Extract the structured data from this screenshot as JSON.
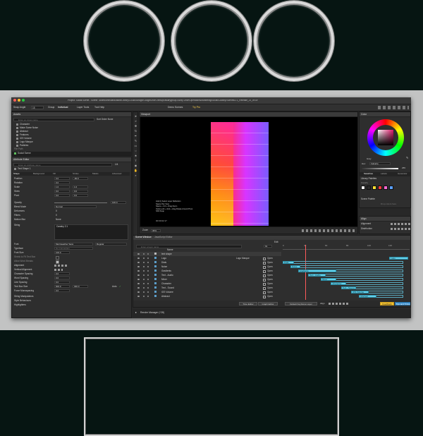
{
  "window": {
    "title": "Project: Social Scene - Scene: /Users/chrishardcastle/Library/CloudStorage/GoogleDrive-chris@cavalrygroup.co/My Drive/Operations/Marketing/Social/Cavalry/Scenes/2.1_Release_21_ch.cv"
  },
  "toolbar": {
    "snap_angle_label": "Snap Angle",
    "snap_angle_value": "15",
    "group_label": "Group",
    "individual_label": "Individual",
    "layer_tools_label": "Layer Tools",
    "tool_help_label": "Tool Help",
    "demo_scenes_label": "Demo Scenes",
    "try_pro_label": "Try Pro"
  },
  "assets": {
    "header": "Assets",
    "search_placeholder": "Enter an Asset name",
    "sort_label": "Sort Order",
    "sort_value": "None",
    "items": [
      "Character",
      "Make Some Noise",
      "Abstract",
      "Features",
      "iOS Volume",
      "Logo Marque",
      "Particles"
    ],
    "file_path_label": "File Path",
    "scene_name": "Social Scene",
    "size_label": "Size"
  },
  "attribute_editor": {
    "header": "Attribute Editor",
    "search_placeholder": "Enter an Attribute name",
    "page": "1/4",
    "layer_name": "Text Shape 1",
    "tabs": [
      "Shape",
      "Background",
      "Fill",
      "Stroke",
      "Masks",
      "Advanced"
    ],
    "rows": [
      {
        "label": "Position",
        "a": "0.0",
        "b": "-80.0"
      },
      {
        "label": "Rotation",
        "a": "0.0",
        "b": ""
      },
      {
        "label": "Scale",
        "a": "1.0",
        "b": "1.0"
      },
      {
        "label": "Skew",
        "a": "0.0",
        "b": "0.0"
      },
      {
        "label": "Pivot",
        "a": "0.0",
        "b": "0.0"
      }
    ],
    "opacity_label": "Opacity",
    "opacity_value": "100.0",
    "blend_mode_label": "Blend Mode",
    "blend_mode_value": "Normal",
    "deformers_label": "Deformers",
    "deformers_value": "0",
    "filters_label": "Filters",
    "filters_value": "0",
    "motion_blur_label": "Motion Blur",
    "motion_blur_value": "None",
    "string_label": "String",
    "string_value": "Cavalry 2.1",
    "font_label": "Font",
    "font_value": "Merriweather Sans",
    "font_style": "Regular",
    "typeface_label": "Typeface",
    "typeface_value": "No Connection",
    "font_size_label": "Font Size",
    "font_size_value": "100.0",
    "shrink_label": "Shrink to Fit Text Box",
    "allow_breaks_label": "Allow Word Breaks",
    "alignment_label": "Alignment",
    "vertical_alignment_label": "Vertical Alignment",
    "character_spacing_label": "Character Spacing",
    "character_spacing_value": "0.0",
    "word_spacing_label": "Word Spacing",
    "word_spacing_value": "0.0",
    "line_spacing_label": "Line Spacing",
    "line_spacing_value": "0.0",
    "text_box_size_label": "Text Box Size",
    "text_box_w": "600.0",
    "text_box_h": "300.0",
    "text_box_auto": "Auto",
    "force_mono_label": "Force Monospacing",
    "force_mono_value": "0.0",
    "string_manipulators_label": "String Manipulators",
    "style_behaviours_label": "Style Behaviours",
    "highlighters_label": "Highlighters"
  },
  "viewport": {
    "header": "Viewport",
    "overlay_lines": [
      "Hold Q  Select Layer Reflection",
      "Space  Pan View",
      "Space + Ctrl + Drag  Zoom",
      "Option+Alt + click + drag  Rotate Around Pivot",
      "Shift  Snap"
    ],
    "time_readout": "00:00:02:17",
    "zoom_label": "Zoom",
    "zoom_value": "36%"
  },
  "color": {
    "header": "Color",
    "mode_label": "Gray",
    "hex_label": "Hex",
    "hex_value": "FaFaFa",
    "alpha_value": "255",
    "tabs": [
      "Swatches",
      "Labels",
      "Generator"
    ],
    "library_label": "Library Palettes",
    "cavalry_label": "Cavalry",
    "swatches": [
      "#f2f2f2",
      "#2a2a2a",
      "#ffe033",
      "#ff3b3b",
      "#ff6ad5",
      "#5aa0ff"
    ],
    "scene_palette_label": "Scene Palette",
    "drop_label": "Drop colors here"
  },
  "align": {
    "header": "Align",
    "alignment_label": "Alignment",
    "distribution_label": "Distribution"
  },
  "scene_window": {
    "tab1": "Scene Window",
    "tab2": "JavaScript Editor",
    "search_placeholder": "Enter a layer name",
    "frame_value": "91",
    "edit_label": "Edit",
    "col_name": "Name",
    "ruler": [
      "0",
      "40",
      "60",
      "80",
      "100",
      "120"
    ],
    "layers": [
      {
        "name": "text shape",
        "input": "",
        "state": ""
      },
      {
        "name": "Logo",
        "input": "Logo Marque",
        "state": "Open"
      },
      {
        "name": "Dials",
        "input": "",
        "state": "Open"
      },
      {
        "name": "Noise",
        "input": "",
        "state": "Open"
      },
      {
        "name": "Gradients",
        "input": "",
        "state": "Open"
      },
      {
        "name": "Text - Audio",
        "input": "",
        "state": "Open"
      },
      {
        "name": "Mixer",
        "input": "",
        "state": "Open"
      },
      {
        "name": "Character",
        "input": "",
        "state": "Open"
      },
      {
        "name": "Text - Sound",
        "input": "",
        "state": "Open"
      },
      {
        "name": "iOS Volume",
        "input": "",
        "state": "Open"
      },
      {
        "name": "Abstract",
        "input": "",
        "state": "Open"
      }
    ],
    "bars": [
      {
        "label": "Logo",
        "start": 0.84,
        "end": 0.99
      },
      {
        "label": "Dials",
        "start": 0.0,
        "end": 0.09
      },
      {
        "label": "Noise",
        "start": 0.06,
        "end": 0.14
      },
      {
        "label": "Gradients",
        "start": 0.12,
        "end": 0.42
      },
      {
        "label": "Text - Audio",
        "start": 0.2,
        "end": 0.34
      },
      {
        "label": "Mixer",
        "start": 0.3,
        "end": 0.42
      },
      {
        "label": "Character",
        "start": 0.38,
        "end": 0.5
      },
      {
        "label": "Text - Sound",
        "start": 0.46,
        "end": 0.58
      },
      {
        "label": "iOS Volume",
        "start": 0.54,
        "end": 0.68
      },
      {
        "label": "Abstract",
        "start": 0.6,
        "end": 0.74
      }
    ],
    "time_editor_label": "Time Editor",
    "graph_editor_label": "Graph Editor",
    "default_keyframe_label": "Default Keyframe Layer",
    "align_label": "Align",
    "feedback_label": "Feedback",
    "tips_label": "Tips and Tricks",
    "render_manager_label": "Render Manager (^28)"
  }
}
